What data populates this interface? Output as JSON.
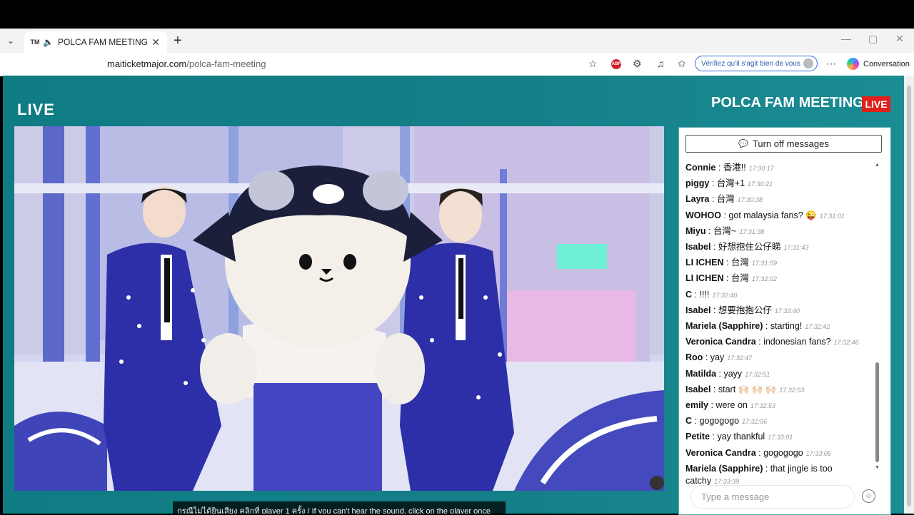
{
  "browser": {
    "tab_title": "POLCA FAM MEETING",
    "tab_favicon": "TM",
    "address": "maiticketmajor.com/polca-fam-meeting",
    "address_domain": "maiticketmajor.com",
    "address_path": "/polca-fam-meeting",
    "verify_label": "Vérifiez qu'il s'agit bien de vous",
    "conversation_label": "Conversation",
    "abp_label": "ABP"
  },
  "page": {
    "live_logo": "LIVE",
    "event_title": "POLCA FAM MEETING",
    "live_badge": "LIVE",
    "caption": "กรณีไม่ได้ยินเสียง คลิกที่ player 1 ครั้ง / If you can't hear the sound, click on the player once"
  },
  "chat": {
    "toggle_label": "Turn off messages",
    "input_placeholder": "Type a message",
    "messages": [
      {
        "user": "Connie",
        "text": "香港!!",
        "time": "17:30:17"
      },
      {
        "user": "piggy",
        "text": "台灣+1",
        "time": "17:30:21"
      },
      {
        "user": "Layra",
        "text": "台灣",
        "time": "17:30:38"
      },
      {
        "user": "WOHOO",
        "text": "got malaysia fans? 😜",
        "time": "17:31:01"
      },
      {
        "user": "Miyu",
        "text": "台灣~",
        "time": "17:31:38"
      },
      {
        "user": "Isabel",
        "text": "好想抱住公仔睇",
        "time": "17:31:43"
      },
      {
        "user": "LI ICHEN",
        "text": "台灣",
        "time": "17:31:59"
      },
      {
        "user": "LI ICHEN",
        "text": "台灣",
        "time": "17:32:02"
      },
      {
        "user": "C",
        "text": "!!!!",
        "time": "17:32:40"
      },
      {
        "user": "Isabel",
        "text": "想要抱抱公仔",
        "time": "17:32:40"
      },
      {
        "user": "Mariela (Sapphire)",
        "text": "starting!",
        "time": "17:32:42"
      },
      {
        "user": "Veronica Candra",
        "text": "indonesian fans?",
        "time": "17:32:46"
      },
      {
        "user": "Roo",
        "text": "yay",
        "time": "17:32:47"
      },
      {
        "user": "Matilda",
        "text": "yayy",
        "time": "17:32:51"
      },
      {
        "user": "Isabel",
        "text": "start 🙌🏻 🙌🏻 🙌🏻",
        "time": "17:32:53"
      },
      {
        "user": "emily",
        "text": "were on",
        "time": "17:32:53"
      },
      {
        "user": "C",
        "text": "gogogogo",
        "time": "17:32:56"
      },
      {
        "user": "Petite",
        "text": "yay thankful",
        "time": "17:33:01"
      },
      {
        "user": "Veronica Candra",
        "text": "gogogogo",
        "time": "17:33:05"
      },
      {
        "user": "Mariela (Sapphire)",
        "text": "that jingle is too catchy",
        "time": "17:33:39"
      }
    ]
  },
  "colors": {
    "page_teal": "#157f88",
    "live_red": "#e0201c",
    "suit_blue": "#2d2fa8"
  },
  "icons": {
    "tab_dropdown": "chevron-down-icon",
    "speaker": "speaker-icon",
    "close": "close-icon",
    "new_tab": "plus-icon",
    "star": "star-icon",
    "extensions": "puzzle-icon",
    "favorites": "favorites-icon",
    "menu": "more-icon",
    "chat_bubble": "chat-bubble-icon",
    "emoji": "emoji-icon"
  }
}
